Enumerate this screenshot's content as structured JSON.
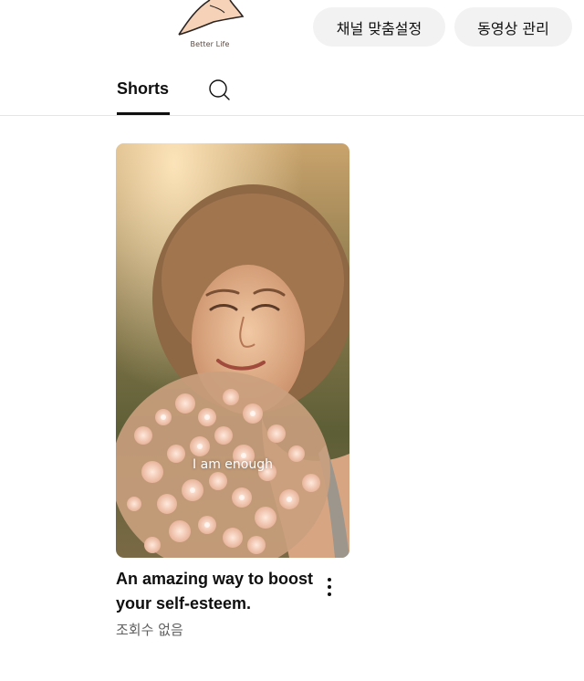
{
  "channel": {
    "logo_text": "Better Life"
  },
  "header": {
    "customize_channel_label": "채널 맞춤설정",
    "manage_videos_label": "동영상 관리"
  },
  "tabs": {
    "shorts_label": "Shorts"
  },
  "video": {
    "caption": "I am enough",
    "title": "An amazing way to boost your self-esteem.",
    "views": "조회수 없음"
  },
  "colors": {
    "text": "#0f0f0f",
    "muted": "#606060",
    "pill_bg": "#f2f2f2",
    "divider": "#e5e5e5"
  },
  "icons": {
    "search": "search-icon",
    "more": "more-vert-icon"
  }
}
